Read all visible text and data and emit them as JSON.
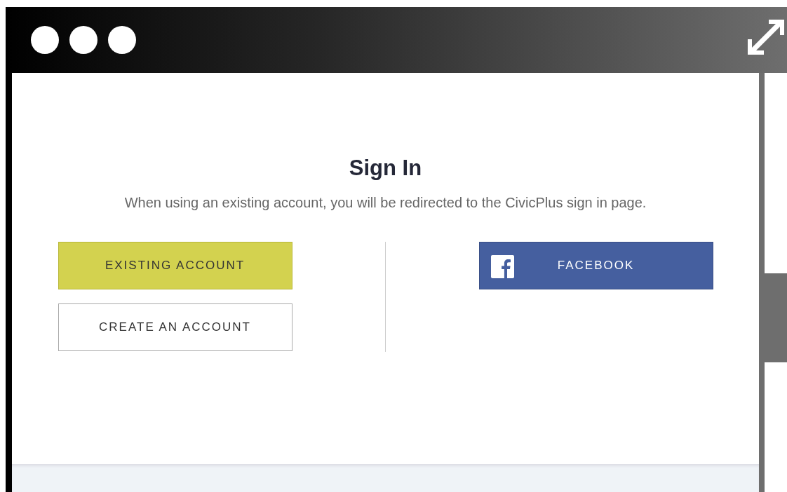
{
  "title": "Sign In",
  "description": "When using an existing account, you will be redirected to the CivicPlus sign in page.",
  "left_buttons": [
    {
      "label": "EXISTING ACCOUNT",
      "kind": "primary"
    },
    {
      "label": "CREATE AN ACCOUNT",
      "kind": "secondary"
    }
  ],
  "right_buttons": [
    {
      "label": "FACEBOOK",
      "kind": "facebook"
    }
  ]
}
